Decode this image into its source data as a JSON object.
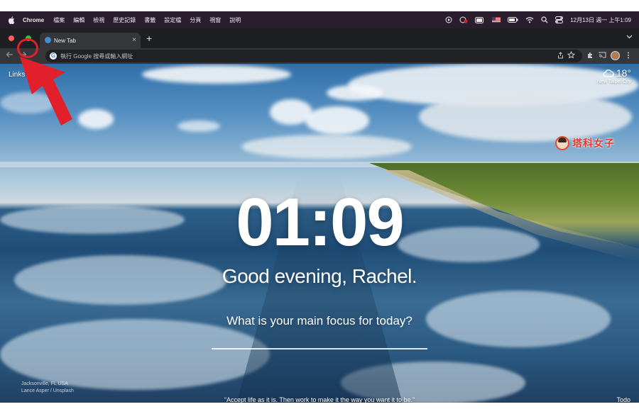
{
  "menubar": {
    "app_name": "Chrome",
    "items": [
      "檔案",
      "編輯",
      "檢視",
      "歷史記錄",
      "書籤",
      "設定檔",
      "分頁",
      "視窗",
      "說明"
    ],
    "datetime": "12月13日 週一 上午1:09"
  },
  "browser": {
    "tab_title": "New Tab",
    "tab_close": "×",
    "new_tab": "+",
    "omnibox_placeholder": "執行 Google 搜尋或輸入網址"
  },
  "page": {
    "links_label": "Links",
    "weather": {
      "temp": "18°",
      "location": "New Taipei City"
    },
    "brand_text": "塔科女子",
    "clock": "01:09",
    "greeting": "Good evening, Rachel.",
    "focus_question": "What is your main focus for today?",
    "photo_location_line1": "Jacksonville, FL USA",
    "photo_credit_line2": "Lance Asper / Unsplash",
    "quote": "“Accept life as it is. Then work to make it the way you want it to be.”",
    "todo_label": "Todo"
  },
  "colors": {
    "annotation_red": "#e2202b",
    "traffic_close": "#ff5f57",
    "traffic_maximize": "#28c840",
    "menubar_bg": "#2a1d2e",
    "brand_red": "#e2362b"
  }
}
